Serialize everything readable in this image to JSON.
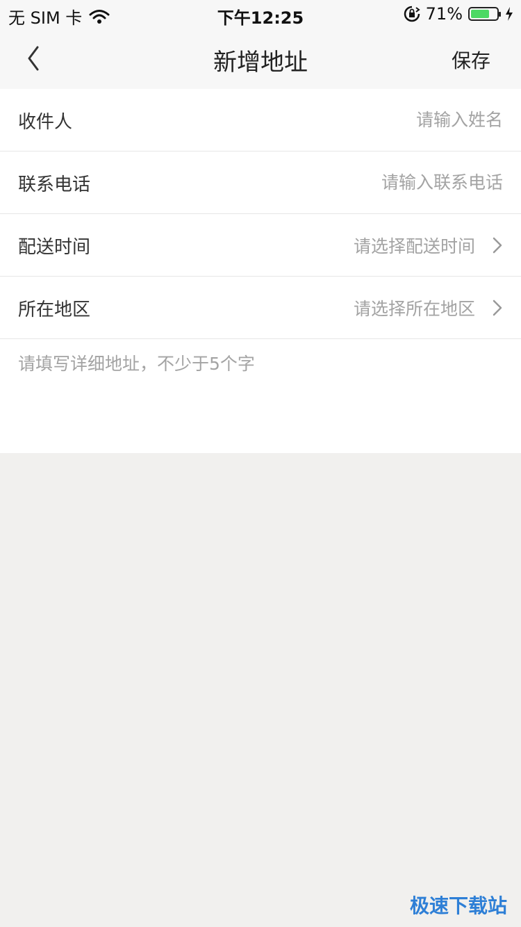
{
  "status_bar": {
    "carrier": "无 SIM 卡",
    "time": "下午12:25",
    "battery_text": "71%",
    "battery_level": 0.71
  },
  "nav": {
    "title": "新增地址",
    "save_label": "保存"
  },
  "form": {
    "recipient": {
      "label": "收件人",
      "placeholder": "请输入姓名"
    },
    "phone": {
      "label": "联系电话",
      "placeholder": "请输入联系电话"
    },
    "delivery_time": {
      "label": "配送时间",
      "value": "请选择配送时间"
    },
    "region": {
      "label": "所在地区",
      "value": "请选择所在地区"
    },
    "address": {
      "placeholder": "请填写详细地址，不少于5个字"
    }
  },
  "watermark": "极速下载站",
  "colors": {
    "page_bg": "#f1f0ee",
    "placeholder": "#a3a3a3",
    "battery_fill": "#4cd964",
    "watermark": "#2e7fd6"
  }
}
